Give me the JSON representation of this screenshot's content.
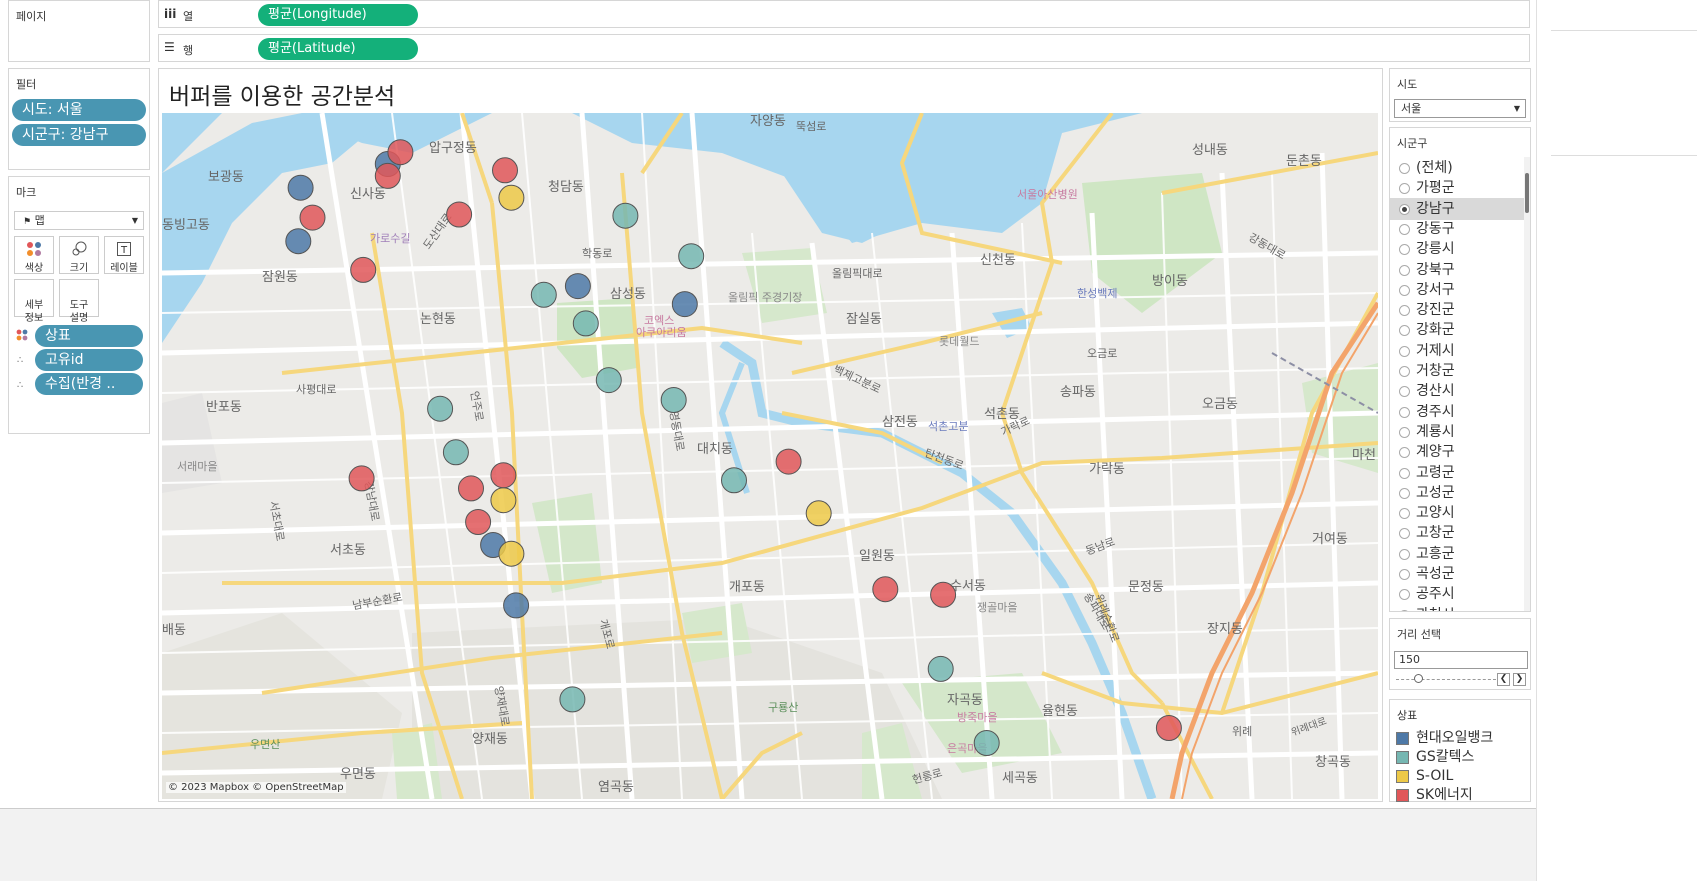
{
  "shelves": {
    "pages_label": "페이지",
    "columns_icon": "iii",
    "columns_label": "열",
    "columns_pill": "평균(Longitude)",
    "rows_icon": "☰",
    "rows_label": "행",
    "rows_pill": "평균(Latitude)"
  },
  "filters": {
    "label": "필터",
    "items": [
      "시도: 서울",
      "시군구: 강남구"
    ]
  },
  "marks": {
    "label": "마크",
    "type_value": "맵",
    "buttons": [
      {
        "name": "color",
        "label": "색상",
        "icon": "dots-icon"
      },
      {
        "name": "size",
        "label": "크기",
        "icon": "circles-icon"
      },
      {
        "name": "label",
        "label": "레이블",
        "icon": "text-icon"
      },
      {
        "name": "detail",
        "label": "세부\n정보",
        "icon": ""
      },
      {
        "name": "tooltip",
        "label": "도구\n설명",
        "icon": ""
      }
    ],
    "fields": [
      "상표",
      "고유id",
      "수집(반경 .."
    ]
  },
  "view": {
    "title": "버퍼를 이용한 공간분석",
    "attribution": "© 2023 Mapbox © OpenStreetMap"
  },
  "right": {
    "sido_label": "시도",
    "sido_value": "서울",
    "sigungu_label": "시군구",
    "sigungu_options": [
      "(전체)",
      "가평군",
      "강남구",
      "강동구",
      "강릉시",
      "강북구",
      "강서구",
      "강진군",
      "강화군",
      "거제시",
      "거창군",
      "경산시",
      "경주시",
      "계룡시",
      "계양구",
      "고령군",
      "고성군",
      "고양시",
      "고창군",
      "고흥군",
      "곡성군",
      "공주시",
      "과천시"
    ],
    "sigungu_selected": "강남구",
    "distance_label": "거리 선택",
    "distance_value": "150",
    "legend_label": "상표",
    "legend": [
      {
        "name": "현대오일뱅크",
        "color": "#4e79a7"
      },
      {
        "name": "GS칼텍스",
        "color": "#76b7b2"
      },
      {
        "name": "S-OIL",
        "color": "#edc948"
      },
      {
        "name": "SK에너지",
        "color": "#e15759"
      }
    ]
  },
  "map": {
    "place_labels": [
      "압구정동",
      "신사동",
      "청담동",
      "자양동",
      "뚝섬로",
      "성내동",
      "둔촌동",
      "보광동",
      "동빙고동",
      "잠원동",
      "가로수길",
      "도산대로",
      "학동로",
      "삼성동",
      "코엑스",
      "아쿠아리움",
      "올림픽대로",
      "올림픽 주경기장",
      "잠실동",
      "신천동",
      "방이동",
      "논현동",
      "사평대로",
      "반포동",
      "롯데월드",
      "송파동",
      "오금동",
      "석촌동",
      "석촌고분",
      "가락동",
      "삼전동",
      "대치동",
      "서래마을",
      "서초동",
      "일원동",
      "개포동",
      "양재동",
      "우면산",
      "우면동",
      "염곡동",
      "구룡산",
      "자곡동",
      "율현동",
      "세곡동",
      "수서동",
      "쟁골마을",
      "문정동",
      "장지동",
      "거여동",
      "마천",
      "창곡동",
      "위례",
      "헌릉로",
      "남부순환로",
      "강남대로",
      "언주로",
      "영동대로",
      "탄천동로",
      "송파대로",
      "양재대로",
      "가락로",
      "강동대로",
      "오금로",
      "백제고분로",
      "서초대로",
      "동남로",
      "방죽마을",
      "은곡마을",
      "배동",
      "한성백제",
      "서울아산병원",
      "위례대로",
      "개포로",
      "위례순환로"
    ],
    "markers": [
      {
        "brand": "현대오일뱅크",
        "lon": 127.0285,
        "lat": 37.527
      },
      {
        "brand": "현대오일뱅크",
        "lon": 127.0175,
        "lat": 37.5232
      },
      {
        "brand": "현대오일뱅크",
        "lon": 127.0172,
        "lat": 37.5146
      },
      {
        "brand": "현대오일뱅크",
        "lon": 127.0525,
        "lat": 37.5074
      },
      {
        "brand": "현대오일뱅크",
        "lon": 127.066,
        "lat": 37.5045
      },
      {
        "brand": "현대오일뱅크",
        "lon": 127.0418,
        "lat": 37.4658
      },
      {
        "brand": "현대오일뱅크",
        "lon": 127.0447,
        "lat": 37.4561
      },
      {
        "brand": "GS칼텍스",
        "lon": 127.0585,
        "lat": 37.5187
      },
      {
        "brand": "GS칼텍스",
        "lon": 127.0668,
        "lat": 37.5122
      },
      {
        "brand": "GS칼텍스",
        "lon": 127.0482,
        "lat": 37.506
      },
      {
        "brand": "GS칼텍스",
        "lon": 127.0535,
        "lat": 37.5014
      },
      {
        "brand": "GS칼텍스",
        "lon": 127.0564,
        "lat": 37.4923
      },
      {
        "brand": "GS칼텍스",
        "lon": 127.0646,
        "lat": 37.4891
      },
      {
        "brand": "GS칼텍스",
        "lon": 127.0351,
        "lat": 37.4877
      },
      {
        "brand": "GS칼텍스",
        "lon": 127.0371,
        "lat": 37.4807
      },
      {
        "brand": "GS칼텍스",
        "lon": 127.0722,
        "lat": 37.4762
      },
      {
        "brand": "GS칼텍스",
        "lon": 127.0983,
        "lat": 37.4459
      },
      {
        "brand": "GS칼텍스",
        "lon": 127.0518,
        "lat": 37.441
      },
      {
        "brand": "GS칼텍스",
        "lon": 127.1041,
        "lat": 37.434
      },
      {
        "brand": "S-OIL",
        "lon": 127.0441,
        "lat": 37.5216
      },
      {
        "brand": "S-OIL",
        "lon": 127.0431,
        "lat": 37.473
      },
      {
        "brand": "S-OIL",
        "lon": 127.0441,
        "lat": 37.4644
      },
      {
        "brand": "S-OIL",
        "lon": 127.0829,
        "lat": 37.4709
      },
      {
        "brand": "SK에너지",
        "lon": 127.0301,
        "lat": 37.5289
      },
      {
        "brand": "SK에너지",
        "lon": 127.0285,
        "lat": 37.5251
      },
      {
        "brand": "SK에너지",
        "lon": 127.0433,
        "lat": 37.526
      },
      {
        "brand": "SK에너지",
        "lon": 127.019,
        "lat": 37.5184
      },
      {
        "brand": "SK에너지",
        "lon": 127.0375,
        "lat": 37.5189
      },
      {
        "brand": "SK에너지",
        "lon": 127.0254,
        "lat": 37.51
      },
      {
        "brand": "SK에너지",
        "lon": 127.0252,
        "lat": 37.4765
      },
      {
        "brand": "SK에너지",
        "lon": 127.0431,
        "lat": 37.477
      },
      {
        "brand": "SK에너지",
        "lon": 127.039,
        "lat": 37.4749
      },
      {
        "brand": "SK에너지",
        "lon": 127.0399,
        "lat": 37.4695
      },
      {
        "brand": "SK에너지",
        "lon": 127.0791,
        "lat": 37.4792
      },
      {
        "brand": "SK에너지",
        "lon": 127.0913,
        "lat": 37.4587
      },
      {
        "brand": "SK에너지",
        "lon": 127.0986,
        "lat": 37.4578
      },
      {
        "brand": "SK에너지",
        "lon": 127.1271,
        "lat": 37.4364
      }
    ]
  }
}
